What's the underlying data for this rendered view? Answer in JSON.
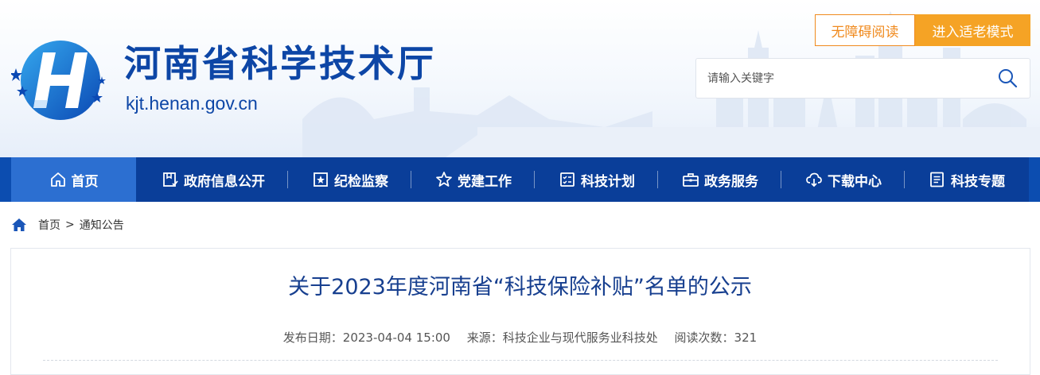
{
  "header": {
    "site_title": "河南省科学技术厅",
    "site_domain": "kjt.henan.gov.cn",
    "accessible_button": "无障碍阅读",
    "elder_button": "进入适老模式",
    "search": {
      "placeholder": "请输入关键字"
    }
  },
  "nav": {
    "items": [
      {
        "label": "首页",
        "icon": "home-icon",
        "active": true
      },
      {
        "label": "政府信息公开",
        "icon": "document-check-icon"
      },
      {
        "label": "纪检监察",
        "icon": "star-badge-icon"
      },
      {
        "label": "党建工作",
        "icon": "star-outline-icon"
      },
      {
        "label": "科技计划",
        "icon": "checklist-icon"
      },
      {
        "label": "政务服务",
        "icon": "briefcase-icon"
      },
      {
        "label": "下载中心",
        "icon": "cloud-download-icon"
      },
      {
        "label": "科技专题",
        "icon": "list-document-icon"
      }
    ]
  },
  "breadcrumb": {
    "home": "首页",
    "separator": ">",
    "current": "通知公告"
  },
  "article": {
    "title": "关于2023年度河南省“科技保险补贴”名单的公示",
    "publish_date": "发布日期：2023-04-04 15:00",
    "source": "来源：科技企业与现代服务业科技处",
    "read_count": "阅读次数：321"
  },
  "colors": {
    "brand_blue": "#0d46a6",
    "nav_bg": "#0a3e99",
    "nav_active": "#2c6fd1",
    "accent_orange": "#f5a325"
  }
}
